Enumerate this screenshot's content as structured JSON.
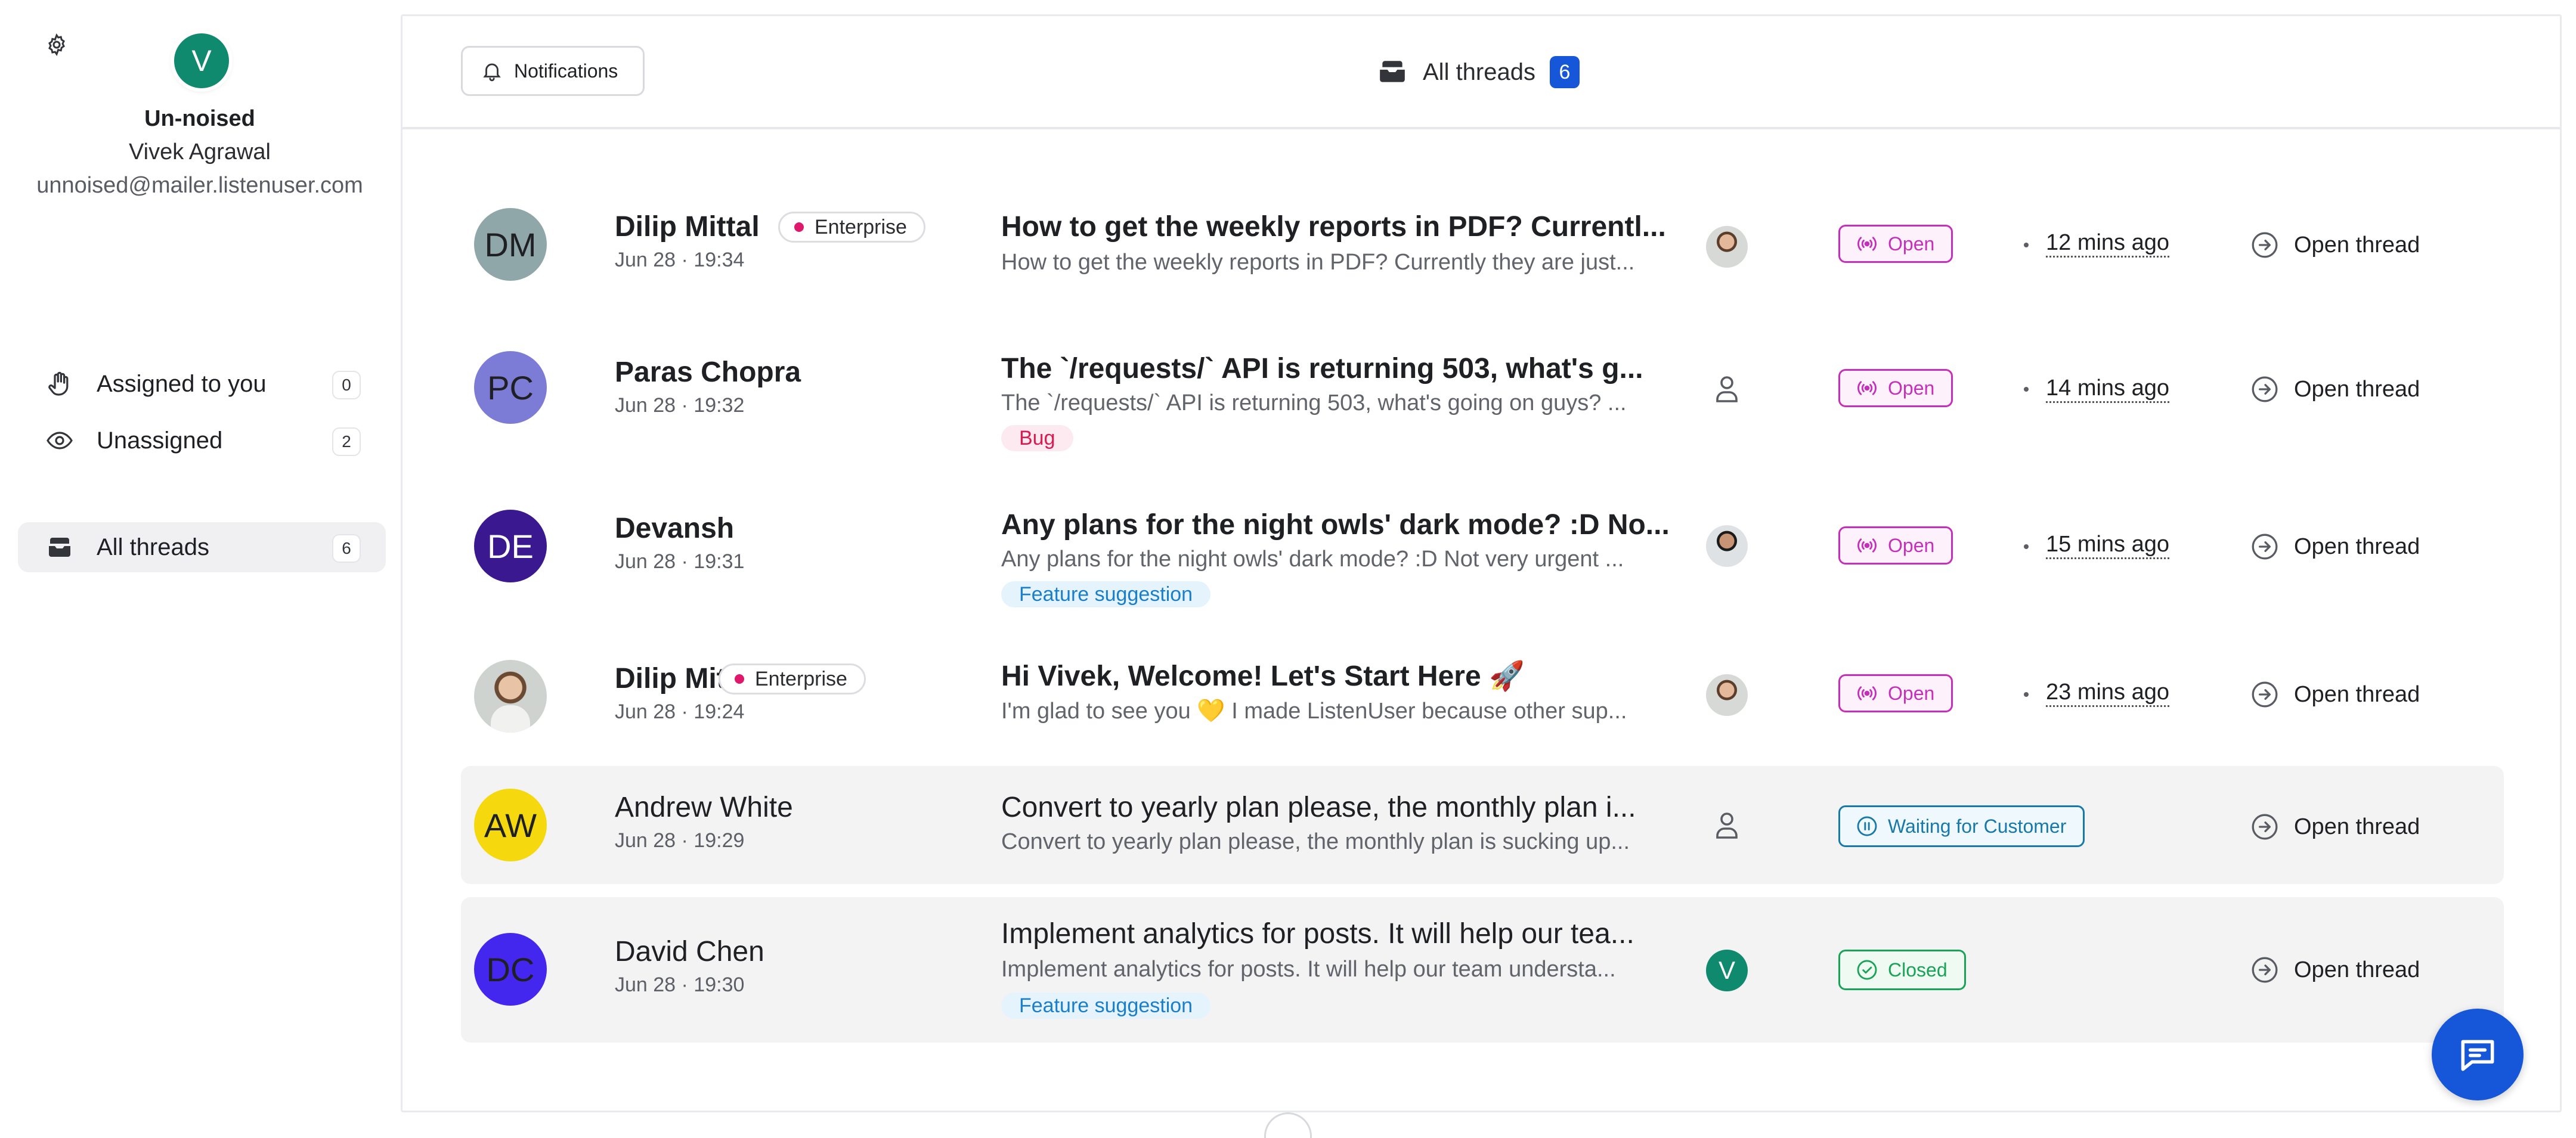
{
  "sidebar": {
    "org_initial": "V",
    "org_name": "Un-noised",
    "user_name": "Vivek Agrawal",
    "user_email": "unnoised@mailer.listenuser.com",
    "nav": [
      {
        "label": "Assigned to you",
        "count": "0",
        "icon": "hand-icon"
      },
      {
        "label": "Unassigned",
        "count": "2",
        "icon": "eye-icon"
      },
      {
        "label": "All threads",
        "count": "6",
        "icon": "inbox-icon"
      }
    ]
  },
  "topbar": {
    "notifications_label": "Notifications",
    "title": "All threads",
    "count": "6"
  },
  "threads": [
    {
      "initials": "DM",
      "name": "Dilip Mittal",
      "date": "Jun 28 · 19:34",
      "badge": "Enterprise",
      "subject": "How to get the weekly reports in PDF? Currentl...",
      "preview": "How to get the weekly reports in PDF? Currently they are just...",
      "tag": "",
      "status": "Open",
      "time_ago": "12 mins ago",
      "action": "Open thread"
    },
    {
      "initials": "PC",
      "name": "Paras Chopra",
      "date": "Jun 28 · 19:32",
      "badge": "",
      "subject": "The `/requests/` API is returning 503, what's g...",
      "preview": "The `/requests/` API is returning 503, what's going on guys? ...",
      "tag": "Bug",
      "status": "Open",
      "time_ago": "14 mins ago",
      "action": "Open thread"
    },
    {
      "initials": "DE",
      "name": "Devansh",
      "date": "Jun 28 · 19:31",
      "badge": "",
      "subject": "Any plans for the night owls' dark mode? :D No...",
      "preview": "Any plans for the night owls' dark mode? :D Not very urgent ...",
      "tag": "Feature suggestion",
      "status": "Open",
      "time_ago": "15 mins ago",
      "action": "Open thread"
    },
    {
      "initials": "",
      "name": "Dilip Mittal",
      "date": "Jun 28 · 19:24",
      "badge": "Enterprise",
      "subject": "Hi Vivek, Welcome! Let's Start Here 🚀",
      "preview": "I'm glad to see you 💛 I made ListenUser because other sup...",
      "tag": "",
      "status": "Open",
      "time_ago": "23 mins ago",
      "action": "Open thread"
    },
    {
      "initials": "AW",
      "name": "Andrew White",
      "date": "Jun 28 · 19:29",
      "badge": "",
      "subject": "Convert to yearly plan please, the monthly plan i...",
      "preview": "Convert to yearly plan please, the monthly plan is sucking up...",
      "tag": "",
      "status": "Waiting for Customer",
      "time_ago": "",
      "action": "Open thread"
    },
    {
      "initials": "DC",
      "name": "David Chen",
      "date": "Jun 28 · 19:30",
      "badge": "",
      "subject": "Implement analytics for posts. It will help our tea...",
      "preview": "Implement analytics for posts. It will help our team understa...",
      "tag": "Feature suggestion",
      "status": "Closed",
      "time_ago": "",
      "action": "Open thread",
      "assignee_initial": "V"
    }
  ],
  "colors": {
    "accent": "#1656d8",
    "open": "#c52fb9",
    "waiting": "#1879a8",
    "closed": "#19a356",
    "org_avatar": "#0f8a6f",
    "avatar_dm": "#8fa7a8",
    "avatar_pc": "#7c7bd6",
    "avatar_de": "#3a1890",
    "avatar_aw": "#f5d90e",
    "avatar_dc": "#4427ee"
  }
}
